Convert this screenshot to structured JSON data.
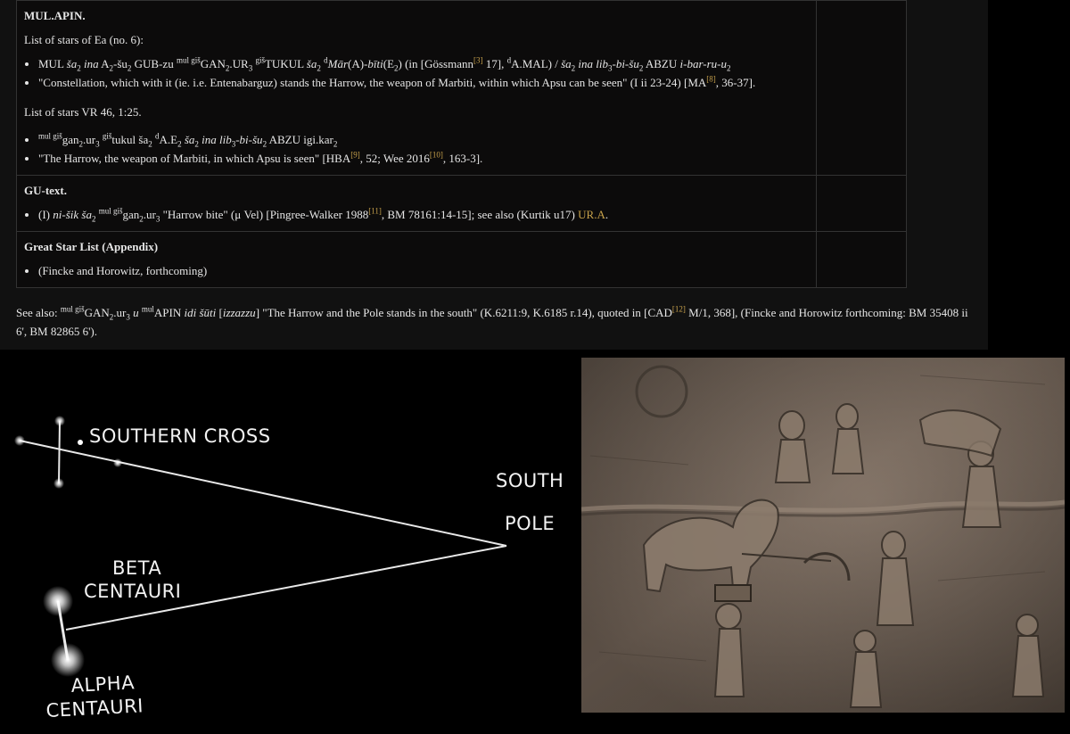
{
  "doc": {
    "mulapin": {
      "heading": "MUL.APIN.",
      "intro": "List of stars of Ea (no. 6):",
      "b1": {
        "a": "MUL ",
        "b": "ša",
        "c": "2",
        "d": " ina",
        "e": " A",
        "f": "2",
        "g": "-šu",
        "h": "2",
        "i": " GUB-zu ",
        "j": "mul giš",
        "k": "GAN",
        "l": "2",
        "m": ".UR",
        "n": "3",
        "o": " ",
        "p": "giš",
        "q": "TUKUL ",
        "r": "ša",
        "s": "2",
        "t": " ",
        "u": "d",
        "v": "Mār",
        "w": "(A)-",
        "x": "bīti",
        "y": "(E",
        "z": "2",
        "aa": ") (in [Gössmann",
        "ab": "[3]",
        "ac": " 17], ",
        "ad": "d",
        "ae": "A.MAL) / ",
        "af": "ša",
        "ag": "2",
        "ah": " ina lib",
        "ai": "3",
        "aj": "-bi-šu",
        "ak": "2",
        "al": " ABZU ",
        "am": "i-bar-ru-u",
        "an": "2"
      },
      "b2": {
        "a": "\"Constellation, which with it (ie. i.e. Entenabarguz) stands the Harrow, the weapon of Marbiti, within which Apsu can be seen\" (I ii 23-24) [MA",
        "b": "[8]",
        "c": ", 36-37]."
      },
      "intro2": "List of stars VR 46, 1:25.",
      "b3": {
        "a": "mul giš",
        "b": "gan",
        "c": "2",
        "d": ".ur",
        "e": "3",
        "f": " ",
        "g": "giš",
        "h": "tukul ša",
        "i": "2",
        "j": " ",
        "k": "d",
        "l": "A.E",
        "m": "2",
        "n": " ",
        "o": "ša",
        "p": "2",
        "q": " ina lib",
        "r": "3",
        "s": "-bi-šu",
        "t": "2",
        "u": " ABZU igi.kar",
        "v": "2"
      },
      "b4": {
        "a": "\"The Harrow, the weapon of Marbiti, in which Apsu is seen\" [HBA",
        "b": "[9]",
        "c": ", 52; Wee 2016",
        "d": "[10]",
        "e": ", 163-3]."
      }
    },
    "gutext": {
      "heading": "GU-text.",
      "b1": {
        "a": "(I) ",
        "b": "ni-šik ša",
        "c": "2",
        "d": " ",
        "e": "mul giš",
        "f": "gan",
        "g": "2",
        "h": ".ur",
        "i": "3",
        "j": " \"Harrow bite\" (μ Vel) [Pingree-Walker 1988",
        "k": "[11]",
        "l": ", BM 78161:14-15]; see also (Kurtik u17) ",
        "m": "UR.A",
        "n": "."
      }
    },
    "greatstar": {
      "heading": "Great Star List (Appendix)",
      "b1": "(Fincke and Horowitz, forthcoming)"
    },
    "seealso": {
      "a": "See also: ",
      "b": "mul giš",
      "c": "GAN",
      "d": "2",
      "e": ".ur",
      "f": "3",
      "g": " u ",
      "h": "mul",
      "i": "APIN ",
      "j": "idi šūti",
      "k": " [",
      "l": "izzazzu",
      "m": "] \"The Harrow and the Pole stands in the south\" (K.6211:9, K.6185 r.14), quoted in [CAD",
      "n": "[12]",
      "o": " M/1, 368], (Fincke and Horowitz forthcoming: BM 35408 ii 6', BM 82865 6')."
    }
  },
  "diagram": {
    "southern_cross": "SOUTHERN CROSS",
    "south": "SOUTH",
    "pole": "POLE",
    "beta1": "BETA",
    "beta2": "CENTAURI",
    "alpha1": "ALPHA",
    "alpha2": "CENTAURI"
  },
  "colors": {
    "link": "#c8a24a",
    "panel": "#111111",
    "table_bg": "#0c0b0b",
    "stone": "#6f6257"
  }
}
